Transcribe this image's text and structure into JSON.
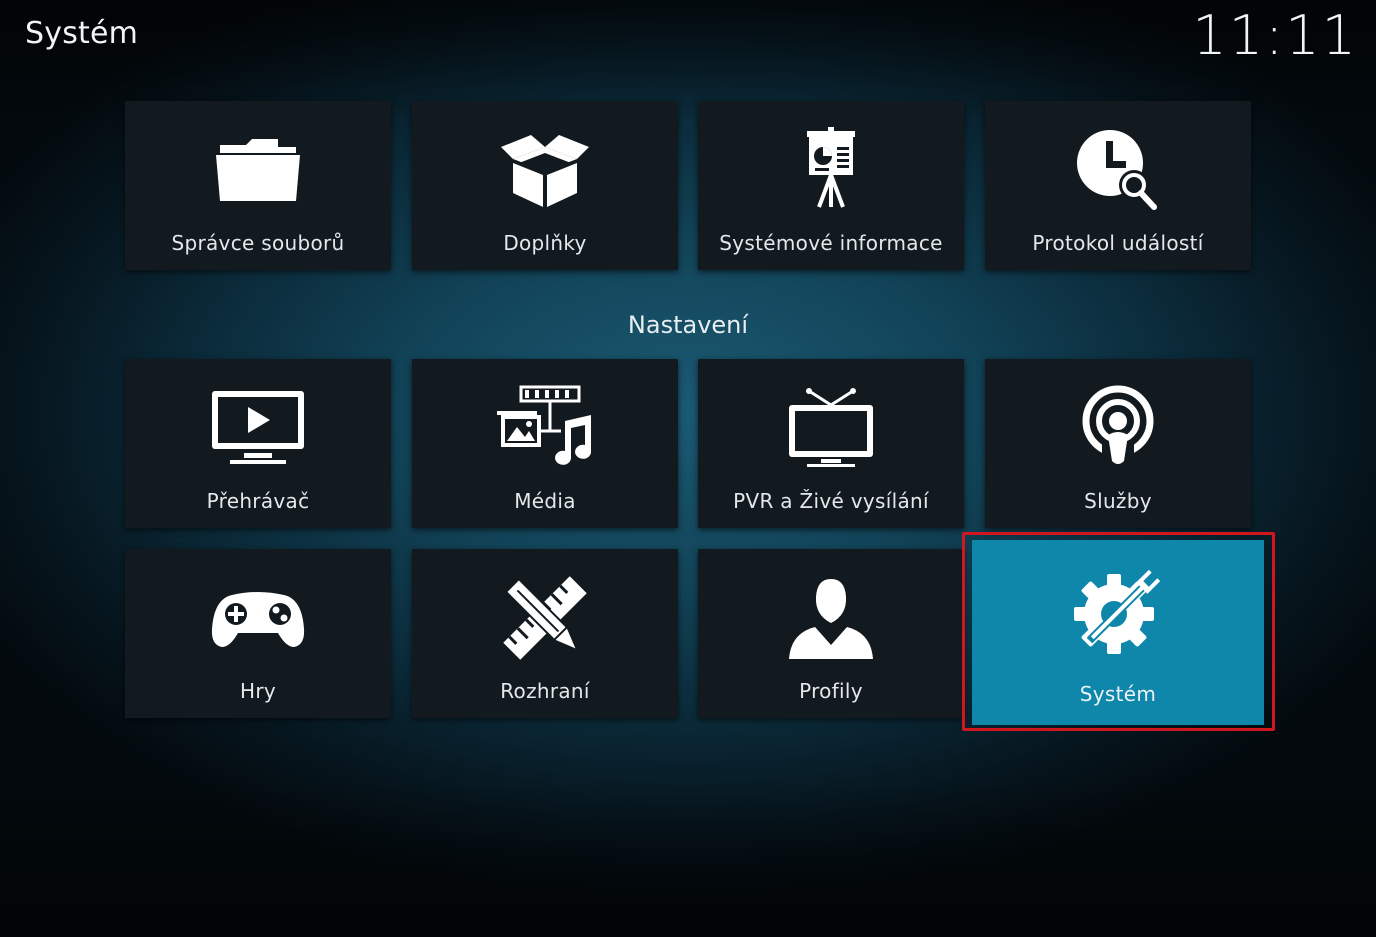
{
  "header": {
    "title": "Systém",
    "clock": "11:11"
  },
  "top_row": [
    {
      "label": "Správce souborů",
      "icon": "folder-icon"
    },
    {
      "label": "Doplňky",
      "icon": "open-box-icon"
    },
    {
      "label": "Systémové informace",
      "icon": "presentation-easel-icon"
    },
    {
      "label": "Protokol událostí",
      "icon": "clock-search-icon"
    }
  ],
  "settings": {
    "heading": "Nastavení",
    "items": [
      {
        "label": "Přehrávač",
        "icon": "monitor-play-icon"
      },
      {
        "label": "Média",
        "icon": "media-collage-icon"
      },
      {
        "label": "PVR a Živé vysílání",
        "icon": "tv-antenna-icon"
      },
      {
        "label": "Služby",
        "icon": "podcast-broadcast-icon"
      },
      {
        "label": "Hry",
        "icon": "gamepad-icon"
      },
      {
        "label": "Rozhraní",
        "icon": "pencil-ruler-icon"
      },
      {
        "label": "Profily",
        "icon": "user-profile-icon"
      },
      {
        "label": "Systém",
        "icon": "gear-wrench-icon",
        "focused": true
      }
    ]
  },
  "colors": {
    "focus_tile": "#0f87ab",
    "tile": "#121a20",
    "highlight_frame": "#d0161f"
  }
}
